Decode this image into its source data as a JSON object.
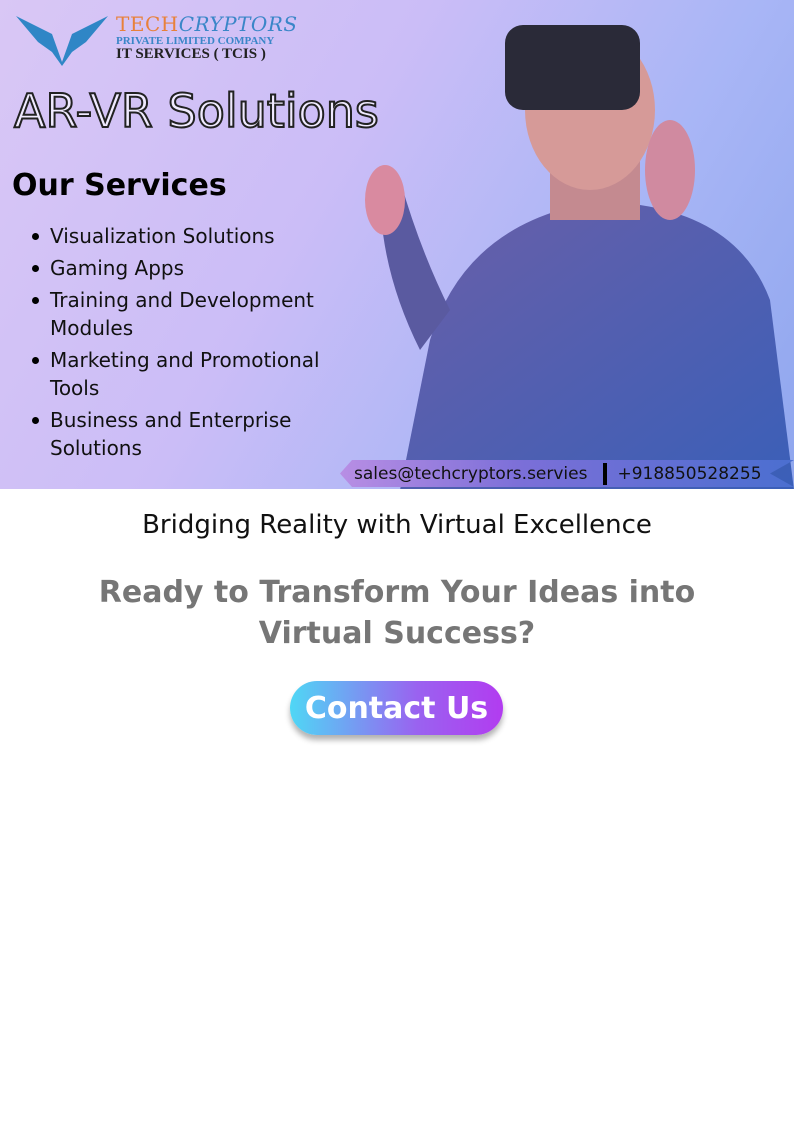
{
  "logo": {
    "brand_a": "TECH",
    "brand_b": "CRYPTORS",
    "line2": "PRIVATE LIMITED COMPANY",
    "line3": "IT SERVICES ( TCIS )"
  },
  "hero": {
    "title": "AR-VR Solutions",
    "services_heading": "Our Services",
    "services": [
      "Visualization Solutions",
      "Gaming Apps",
      "Training and Development Modules",
      "Marketing and Promotional Tools",
      "Business and Enterprise Solutions"
    ]
  },
  "contact": {
    "email": "sales@techcryptors.servies",
    "phone": "+918850528255"
  },
  "tagline": "Bridging Reality with Virtual Excellence",
  "cta": {
    "question": "Ready to Transform Your Ideas into Virtual Success?",
    "button": "Contact Us"
  }
}
